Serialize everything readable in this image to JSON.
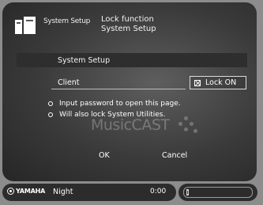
{
  "header": {
    "left_title": "System Setup",
    "right_line1": "Lock function",
    "right_line2": "System Setup"
  },
  "section": {
    "title": "System Setup"
  },
  "client": {
    "label": "Client"
  },
  "lock": {
    "label": "Lock ON",
    "checked": true
  },
  "notes": [
    "Input password to open this page.",
    "Will also lock System Utilities."
  ],
  "watermark": {
    "text": "MusicCAST"
  },
  "buttons": {
    "ok": "OK",
    "cancel": "Cancel"
  },
  "status": {
    "brand": "YAMAHA",
    "source": "Night",
    "time": "0:00",
    "volume_level": 0.03
  }
}
